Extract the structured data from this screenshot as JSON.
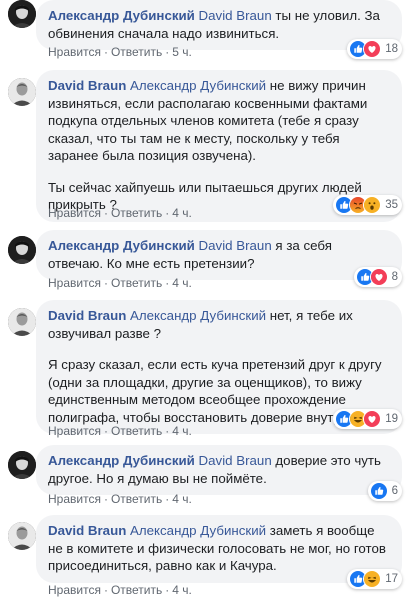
{
  "colors": {
    "name_link": "#385898",
    "bubble_bg": "#f2f3f5",
    "meta_text": "#606770",
    "like_blue": "#1877f2",
    "love_red": "#f33e58",
    "emoji_yellow": "#f7b125"
  },
  "comments": [
    {
      "author": "Александр Дубинский",
      "mention": "David Braun",
      "paragraphs": [
        "ты не уловил. За обвинения сначала надо извиниться."
      ],
      "like_label": "Нравится",
      "reply_label": "Ответить",
      "time": "5 ч.",
      "reactions": [
        "like-icon",
        "love-icon"
      ],
      "reaction_count": "18"
    },
    {
      "author": "David Braun",
      "mention": "Александр Дубинский",
      "paragraphs": [
        "не вижу причин извиняться, если располагаю косвенными фактами подкупа отдельных членов комитета (тебе я сразу сказал, что ты там не к месту, поскольку у тебя заранее была позиция озвучена).",
        "Ты сейчас хайпуешь или пытаешься других людей прикрыть ?"
      ],
      "like_label": "Нравится",
      "reply_label": "Ответить",
      "time": "4 ч.",
      "reactions": [
        "like-icon",
        "angry-icon",
        "wow-icon"
      ],
      "reaction_count": "35"
    },
    {
      "author": "Александр Дубинский",
      "mention": "David Braun",
      "paragraphs": [
        "я за себя отвечаю. Ко мне есть претензии?"
      ],
      "like_label": "Нравится",
      "reply_label": "Ответить",
      "time": "4 ч.",
      "reactions": [
        "like-icon",
        "love-icon"
      ],
      "reaction_count": "8"
    },
    {
      "author": "David Braun",
      "mention": "Александр Дубинский",
      "paragraphs": [
        "нет, я тебе их озвучивал разве ?",
        "Я сразу сказал, если есть куча претензий друг к другу (одни за площадки, другие за оценщиков), то вижу единственным методом всеобщее прохождение полиграфа, чтобы восстановить доверие внутри."
      ],
      "like_label": "Нравится",
      "reply_label": "Ответить",
      "time": "4 ч.",
      "reactions": [
        "like-icon",
        "haha-icon",
        "love-icon"
      ],
      "reaction_count": "19"
    },
    {
      "author": "Александр Дубинский",
      "mention": "David Braun",
      "paragraphs": [
        "доверие это чуть другое. Но я думаю вы не поймёте."
      ],
      "like_label": "Нравится",
      "reply_label": "Ответить",
      "time": "4 ч.",
      "reactions": [
        "like-icon"
      ],
      "reaction_count": "6"
    },
    {
      "author": "David Braun",
      "mention": "Александр Дубинский",
      "paragraphs": [
        "заметь я вообще не в комитете и физически голосовать не мог, но готов присоединиться, равно как и Качура."
      ],
      "like_label": "Нравится",
      "reply_label": "Ответить",
      "time": "4 ч.",
      "reactions": [
        "like-icon",
        "haha-icon"
      ],
      "reaction_count": "17"
    }
  ]
}
